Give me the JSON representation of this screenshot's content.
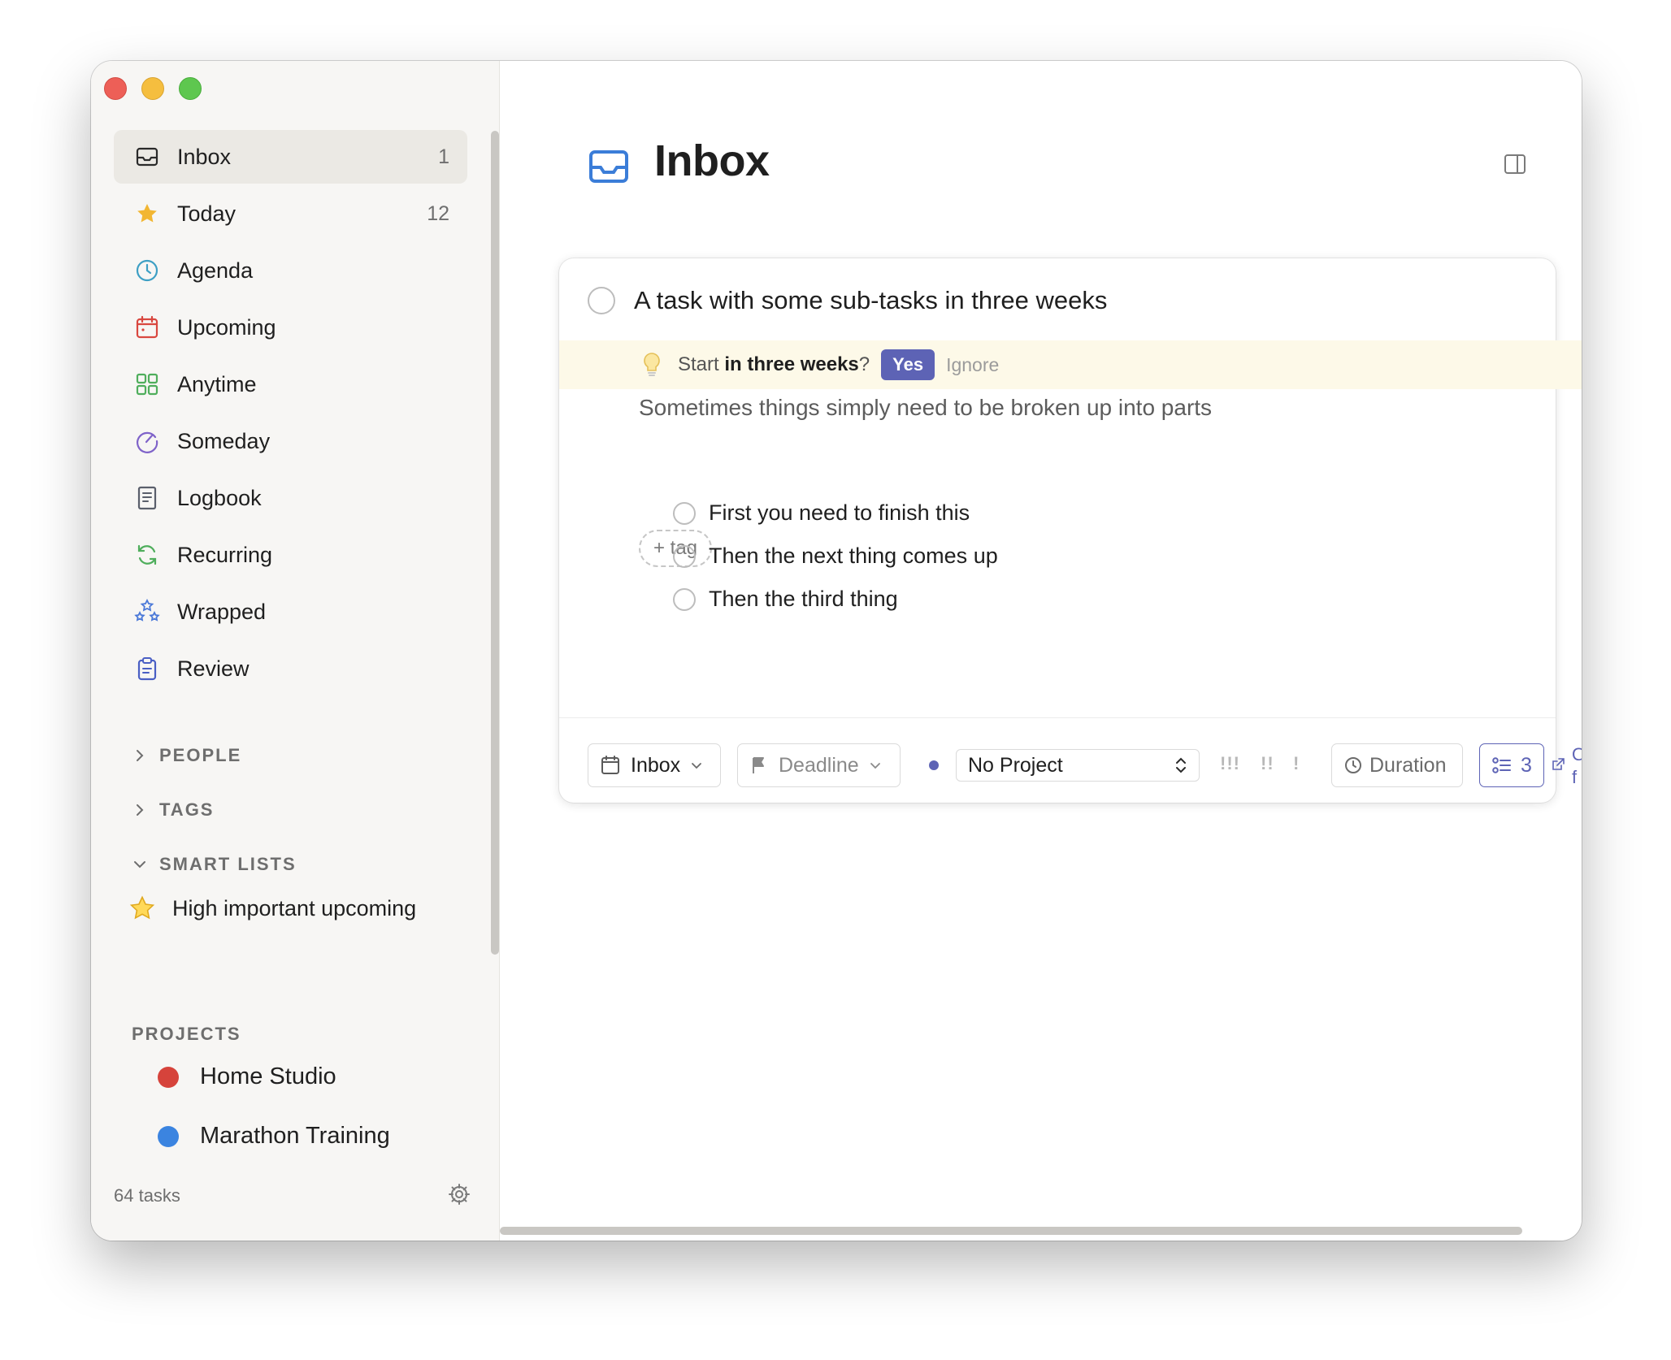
{
  "sidebar": {
    "items": [
      {
        "label": "Inbox",
        "count": "1",
        "icon": "inbox-icon"
      },
      {
        "label": "Today",
        "count": "12",
        "icon": "star-icon"
      },
      {
        "label": "Agenda",
        "count": "",
        "icon": "clock-icon"
      },
      {
        "label": "Upcoming",
        "count": "",
        "icon": "calendar-icon"
      },
      {
        "label": "Anytime",
        "count": "",
        "icon": "grid-icon"
      },
      {
        "label": "Someday",
        "count": "",
        "icon": "someday-icon"
      },
      {
        "label": "Logbook",
        "count": "",
        "icon": "logbook-icon"
      },
      {
        "label": "Recurring",
        "count": "",
        "icon": "recurring-icon"
      },
      {
        "label": "Wrapped",
        "count": "",
        "icon": "stars-icon"
      },
      {
        "label": "Review",
        "count": "",
        "icon": "clipboard-icon"
      }
    ],
    "sections": {
      "people": "PEOPLE",
      "tags": "TAGS",
      "smart_lists": "SMART LISTS"
    },
    "smart_list_items": [
      {
        "label": "High important upcoming",
        "icon": "star-outline-icon"
      }
    ],
    "projects_title": "PROJECTS",
    "projects": [
      {
        "name": "Home Studio",
        "color": "#d6433b"
      },
      {
        "name": "Marathon Training",
        "color": "#3b84e0"
      }
    ],
    "footer": {
      "task_count": "64 tasks"
    }
  },
  "main": {
    "title": "Inbox",
    "task": {
      "title": "A task with some sub-tasks in three weeks",
      "suggestion": {
        "prefix": "Start",
        "phrase": "in three weeks",
        "suffix": "?",
        "yes": "Yes",
        "ignore": "Ignore"
      },
      "notes": "Sometimes things simply need to be broken up into parts",
      "tag_button": "+ tag",
      "subtasks": [
        "First you need to finish this",
        "Then the next thing comes up",
        "Then the third thing"
      ],
      "toolbar": {
        "list": "Inbox",
        "deadline": "Deadline",
        "project": "No Project",
        "priority_high": "!!!",
        "priority_medium": "!!",
        "priority_low": "!",
        "duration": "Duration",
        "subtask_count": "3",
        "cut_text": "O\nf"
      }
    }
  },
  "colors": {
    "accent": "#5d63b5",
    "inbox_blue": "#3b7dd8",
    "suggestion_bg": "#fdf9e8",
    "sidebar_bg": "#f7f6f4"
  }
}
